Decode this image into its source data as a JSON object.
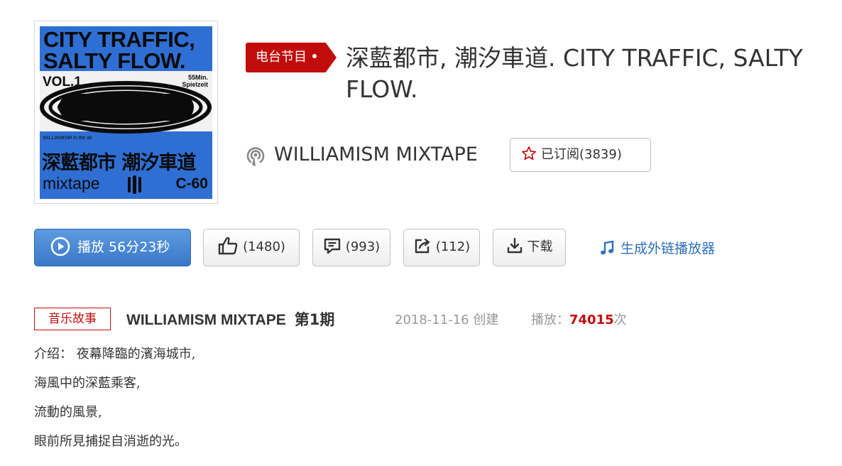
{
  "cover": {
    "title_line1": "CITY TRAFFIC,",
    "title_line2": "SALTY FLOW.",
    "vol": "VOL.1",
    "duration_line1": "55Min.",
    "duration_line2": "Spielzeit",
    "credit": "WILLIAMISM in the air",
    "cjk_title": "深藍都市 潮汐車道",
    "mixtape": "mixtape",
    "cassette": "C-60"
  },
  "header": {
    "tag": "电台节目",
    "title": "深藍都市, 潮汐車道. CITY TRAFFIC, SALTY FLOW.",
    "radio_name": "WILLIAMISM MIXTAPE",
    "subscribe_label": "已订阅(3839)"
  },
  "actions": {
    "play_label": "播放 56分23秒",
    "like_count": "(1480)",
    "comment_count": "(993)",
    "share_count": "(112)",
    "download_label": "下载",
    "generate_link": "生成外链播放器"
  },
  "episode": {
    "category": "音乐故事",
    "program": "WILLIAMISM MIXTAPE",
    "number": "第1期",
    "date": "2018-11-16 创建",
    "plays_prefix": "播放：",
    "plays_count": "74015",
    "plays_suffix": "次"
  },
  "description": {
    "lines": [
      "介绍： 夜幕降臨的濱海城市,",
      "海風中的深藍乘客,",
      "流動的風景,",
      "眼前所見捕捉自消逝的光。"
    ]
  },
  "colors": {
    "accent_red": "#c20c0c",
    "play_blue": "#3a78c8",
    "link_blue": "#2f6fb8",
    "cover_blue": "#2f6fd3"
  },
  "icons": {
    "play": "play-circle-icon",
    "like": "thumbs-up-icon",
    "comment": "comment-icon",
    "share": "share-icon",
    "download": "download-icon",
    "music": "music-note-icon",
    "radio": "radio-icon",
    "star": "star-icon"
  }
}
